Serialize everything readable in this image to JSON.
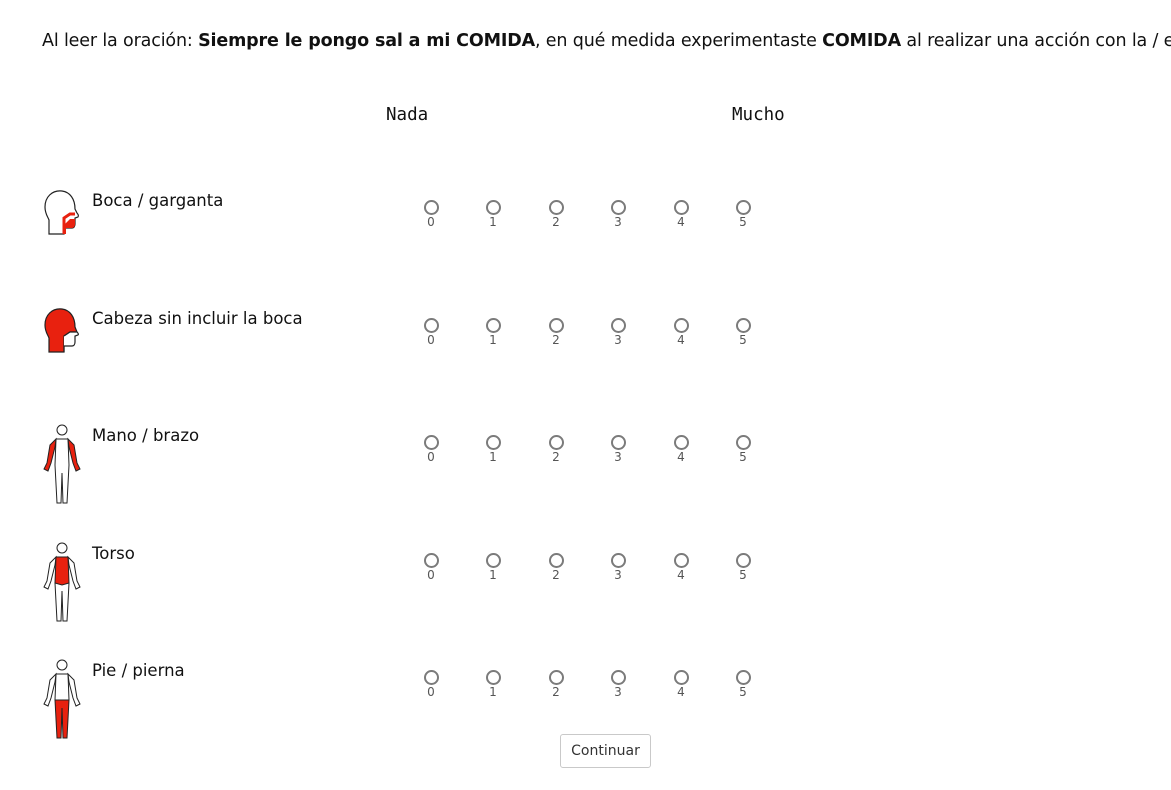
{
  "question": {
    "prefix": "Al leer la oración: ",
    "sentence": "Siempre le pongo sal a mi COMIDA",
    "middle": ", en qué medida experimentaste ",
    "target": "COMIDA",
    "suffix": " al realizar una acción con la / el..."
  },
  "scale": {
    "left_anchor": "Nada",
    "right_anchor": "Mucho",
    "options": [
      "0",
      "1",
      "2",
      "3",
      "4",
      "5"
    ],
    "selected": null
  },
  "rows": [
    {
      "label": "Boca / garganta",
      "icon": "mouth-throat-icon"
    },
    {
      "label": "Cabeza sin incluir la boca",
      "icon": "head-icon"
    },
    {
      "label": "Mano / brazo",
      "icon": "hand-arm-body-icon"
    },
    {
      "label": "Torso",
      "icon": "torso-body-icon"
    },
    {
      "label": "Pie / pierna",
      "icon": "foot-leg-body-icon"
    }
  ],
  "colors": {
    "highlight": "#e8210f",
    "radio_border": "#7b7b7b"
  },
  "continue_label": "Continuar"
}
